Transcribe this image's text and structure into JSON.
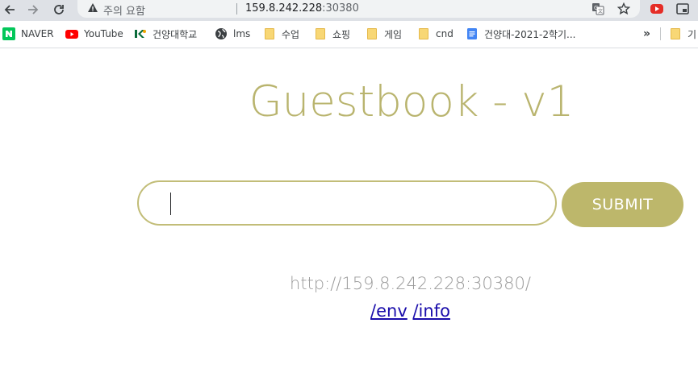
{
  "browser": {
    "security_warning": "주의 요함",
    "url_host": "159.8.242.228",
    "url_port": ":30380",
    "bookmarks": [
      {
        "label": "NAVER",
        "icon": "naver-icon"
      },
      {
        "label": "YouTube",
        "icon": "youtube-icon"
      },
      {
        "label": "건양대학교",
        "icon": "konyang-icon"
      },
      {
        "label": "lms",
        "icon": "globe-icon"
      },
      {
        "label": "수업",
        "icon": "folder-icon"
      },
      {
        "label": "쇼핑",
        "icon": "folder-icon"
      },
      {
        "label": "게임",
        "icon": "folder-icon"
      },
      {
        "label": "cnd",
        "icon": "folder-icon"
      },
      {
        "label": "건양대-2021-2학기...",
        "icon": "docs-icon"
      }
    ],
    "overflow_label": "»",
    "other_bookmarks_label": "기"
  },
  "page": {
    "title": "Guestbook - v1",
    "input_placeholder": "",
    "submit_label": "SUBMIT",
    "host_url": "http://159.8.242.228:30380/",
    "links": [
      "/env",
      "/info"
    ]
  },
  "colors": {
    "accent": "#bdb76b",
    "title": "#b9b46e",
    "link": "#1a0dab"
  }
}
